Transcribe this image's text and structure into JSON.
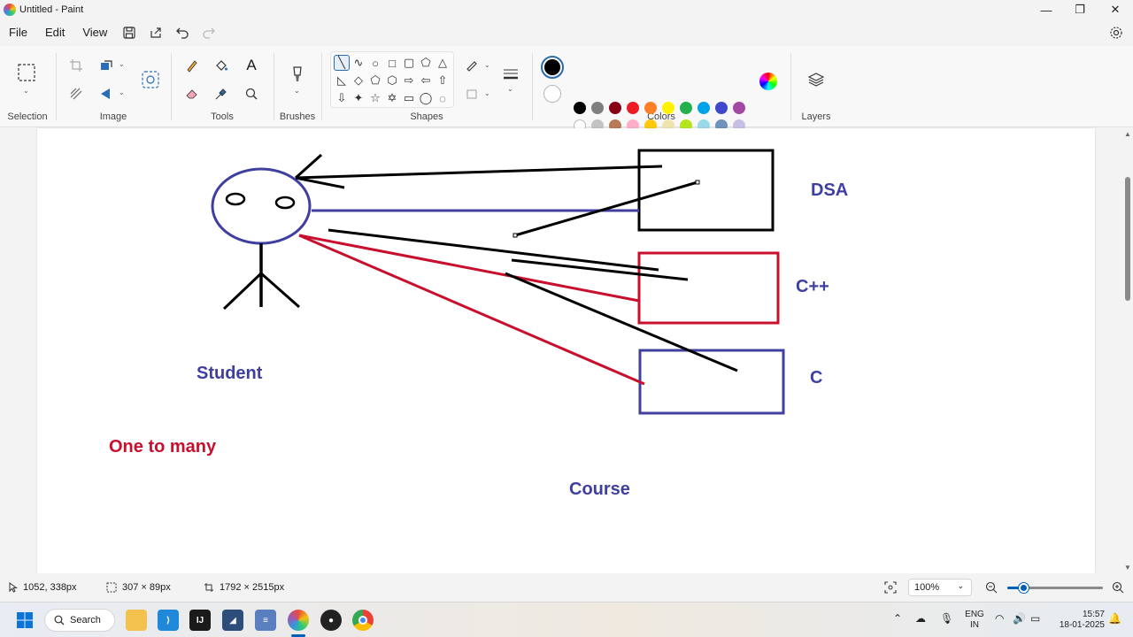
{
  "window": {
    "title": "Untitled - Paint",
    "minimize": "—",
    "maximize": "❐",
    "close": "✕"
  },
  "menu": {
    "file": "File",
    "edit": "Edit",
    "view": "View"
  },
  "ribbon": {
    "selection_label": "Selection",
    "image_label": "Image",
    "tools_label": "Tools",
    "brushes_label": "Brushes",
    "shapes_label": "Shapes",
    "colors_label": "Colors",
    "layers_label": "Layers"
  },
  "shapes": [
    "╲",
    "∿",
    "○",
    "□",
    "▢",
    "⬠",
    "△",
    "◺",
    "◇",
    "⬠",
    "⬡",
    "⇨",
    "⇦",
    "⇧",
    "⇩",
    "✦",
    "☆",
    "✡",
    "▭",
    "◯",
    "◌"
  ],
  "colors": {
    "primary": "#000000",
    "secondary": "#ffffff",
    "palette_row1": [
      "#000000",
      "#7f7f7f",
      "#880015",
      "#ed1c24",
      "#ff7f27",
      "#fff200",
      "#22b14c",
      "#00a2e8",
      "#3f48cc",
      "#a349a4"
    ],
    "palette_row2": [
      "#ffffff",
      "#c3c3c3",
      "#b97a57",
      "#ffaec9",
      "#ffc90e",
      "#efe4b0",
      "#b5e61d",
      "#99d9ea",
      "#7092be",
      "#c8bfe7"
    ]
  },
  "canvas": {
    "labels": {
      "dsa": "DSA",
      "cpp": "C++",
      "c": "C",
      "student": "Student",
      "one_to_many": "One to many",
      "course": "Course"
    },
    "colors": {
      "blue": "#3f3fa0",
      "red": "#c8102e",
      "black": "#000000"
    }
  },
  "status": {
    "cursor_pos": "1052, 338px",
    "selection_size": "307 × 89px",
    "canvas_size": "1792 × 2515px",
    "zoom": "100%"
  },
  "taskbar": {
    "search": "Search",
    "lang_line1": "ENG",
    "lang_line2": "IN",
    "time": "15:57",
    "date": "18-01-2025"
  }
}
